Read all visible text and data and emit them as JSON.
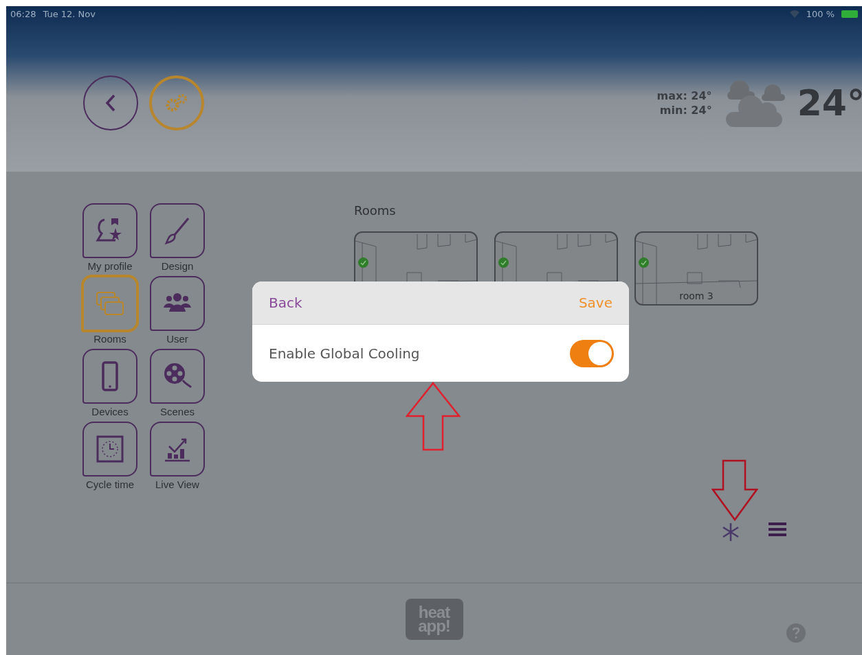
{
  "status_bar": {
    "time": "06:28",
    "date": "Tue 12. Nov",
    "battery": "100 %"
  },
  "header": {
    "weather": {
      "max": "max: 24°",
      "min": "min: 24°",
      "temperature": "24°"
    }
  },
  "menu": [
    {
      "kind": "profile",
      "label": "My profile",
      "selected": false
    },
    {
      "kind": "design",
      "label": "Design",
      "selected": false
    },
    {
      "kind": "rooms",
      "label": "Rooms",
      "selected": true
    },
    {
      "kind": "user",
      "label": "User",
      "selected": false
    },
    {
      "kind": "devices",
      "label": "Devices",
      "selected": false
    },
    {
      "kind": "scenes",
      "label": "Scenes",
      "selected": false
    },
    {
      "kind": "cycle",
      "label": "Cycle time",
      "selected": false
    },
    {
      "kind": "live",
      "label": "Live View",
      "selected": false
    }
  ],
  "rooms": {
    "title": "Rooms",
    "items": [
      {
        "active": true
      },
      {
        "active": true
      },
      {
        "active": true,
        "label": "room 3"
      }
    ]
  },
  "dialog": {
    "back": "Back",
    "save": "Save",
    "setting": {
      "label": "Enable Global Cooling",
      "on": true
    }
  },
  "footer": {
    "logo": {
      "line1": "heat",
      "line2": "app!"
    }
  }
}
